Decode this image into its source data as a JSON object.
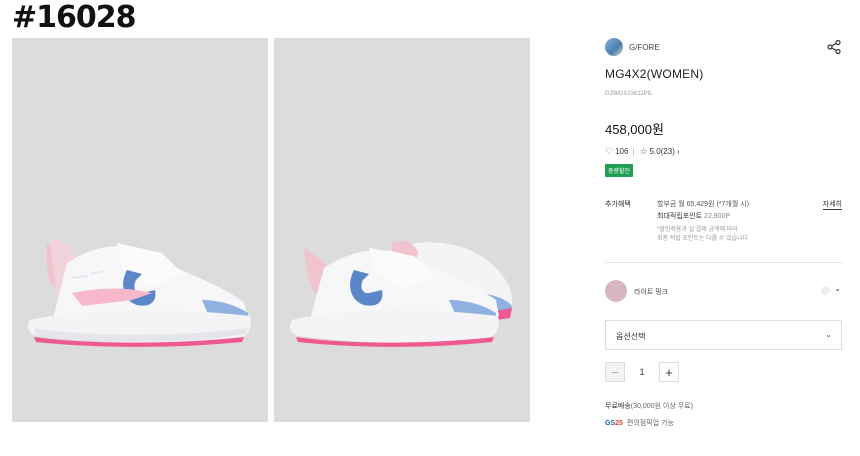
{
  "page_id": "#16028",
  "gallery": {
    "images": [
      {
        "alt": "single shoe side view"
      },
      {
        "alt": "pair of shoes angled view"
      }
    ]
  },
  "product": {
    "brand": "G/FORE",
    "title": "MG4X2(WOMEN)",
    "code": "G2WGX23611PIL",
    "price": "458,000원",
    "likes": "106",
    "rating": "5.0(23)",
    "rating_arrow": "›",
    "badge": "중량할인"
  },
  "benefits": {
    "label": "추가혜택",
    "line1": "할부금 월 65,429원 (*7개월 시)",
    "line2_label": "최대적립포인트",
    "line2_value": "22,900P",
    "note1": "*할인적용과 실 결제 금액에 따라",
    "note2": "최종 적립 포인트는 다를 수 있습니다",
    "detail_link": "자세히"
  },
  "color": {
    "name": "라이트 핑크",
    "swatch": "#d7b6bf"
  },
  "option_select": {
    "placeholder": "옵션선택"
  },
  "quantity": {
    "value": "1",
    "minus": "−",
    "plus": "+"
  },
  "shipping": {
    "free_label": "무료배송",
    "condition": "(30,000원 이상 무료)"
  },
  "pickup": {
    "logo_g": "GS",
    "logo_n": "25",
    "text": "편의점픽업 가능"
  },
  "colors": {
    "accent_green": "#1e9f52",
    "photo_bg": "#dcdcdc"
  }
}
